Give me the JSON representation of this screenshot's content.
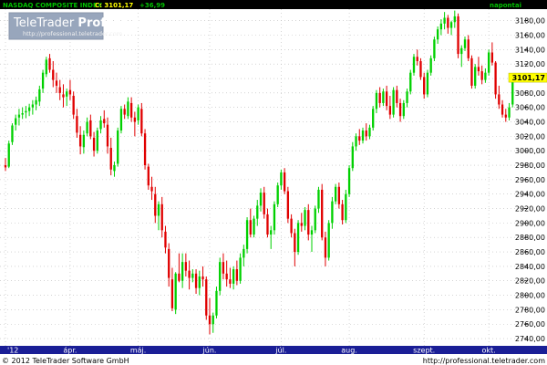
{
  "header": {
    "instrument": "NASDAQ COMPOSITE INDEX",
    "close_label": "C: 3101,17",
    "change": "+36,99",
    "range": "napontai"
  },
  "watermark": {
    "brand_plain": "TeleTrader ",
    "brand_bold": "Professional",
    "url": "http://professional.teletrader.com"
  },
  "footer": {
    "copyright": "© 2012 TeleTrader Software GmbH",
    "url": "http://professional.teletrader.com"
  },
  "colors": {
    "up": "#00d000",
    "down": "#e00000",
    "header_bg": "#000000",
    "header_text": "#00c000",
    "price_badge": "#ffff00",
    "axis_bar": "#1a1e96",
    "grid": "#bbbbbb"
  },
  "chart_data": {
    "type": "candlestick",
    "y_ticks": [
      "3180,00",
      "3160,00",
      "3140,00",
      "3120,00",
      "3100,00",
      "3080,00",
      "3060,00",
      "3040,00",
      "3020,00",
      "3000,00",
      "2980,00",
      "2960,00",
      "2940,00",
      "2920,00",
      "2900,00",
      "2880,00",
      "2860,00",
      "2840,00",
      "2820,00",
      "2800,00",
      "2780,00",
      "2760,00",
      "2740,00"
    ],
    "y_tick_values": [
      3180,
      3160,
      3140,
      3120,
      3100,
      3080,
      3060,
      3040,
      3020,
      3000,
      2980,
      2960,
      2940,
      2920,
      2900,
      2880,
      2860,
      2840,
      2820,
      2800,
      2780,
      2760,
      2740
    ],
    "ylim": [
      2730,
      3196
    ],
    "x_ticks": [
      {
        "label": "'12",
        "index": 0
      },
      {
        "label": "ápr.",
        "index": 19
      },
      {
        "label": "máj.",
        "index": 39
      },
      {
        "label": "jún.",
        "index": 60
      },
      {
        "label": "júl.",
        "index": 81
      },
      {
        "label": "aug.",
        "index": 101
      },
      {
        "label": "szept.",
        "index": 123
      },
      {
        "label": "okt.",
        "index": 142
      }
    ],
    "last_price": "3101,17",
    "last_value": 3101.17,
    "ohlc": [
      [
        2980,
        2990,
        2972,
        2977
      ],
      [
        2978,
        3014,
        2976,
        3010
      ],
      [
        3012,
        3038,
        3008,
        3035
      ],
      [
        3036,
        3050,
        3028,
        3045
      ],
      [
        3046,
        3058,
        3035,
        3050
      ],
      [
        3050,
        3060,
        3044,
        3052
      ],
      [
        3053,
        3062,
        3045,
        3055
      ],
      [
        3055,
        3065,
        3048,
        3060
      ],
      [
        3060,
        3070,
        3050,
        3064
      ],
      [
        3064,
        3075,
        3056,
        3070
      ],
      [
        3068,
        3090,
        3062,
        3085
      ],
      [
        3086,
        3112,
        3080,
        3108
      ],
      [
        3106,
        3130,
        3102,
        3126
      ],
      [
        3128,
        3134,
        3108,
        3112
      ],
      [
        3112,
        3124,
        3088,
        3098
      ],
      [
        3097,
        3108,
        3080,
        3090
      ],
      [
        3088,
        3098,
        3070,
        3080
      ],
      [
        3078,
        3092,
        3060,
        3074
      ],
      [
        3075,
        3086,
        3062,
        3082
      ],
      [
        3084,
        3098,
        3070,
        3078
      ],
      [
        3076,
        3082,
        3044,
        3050
      ],
      [
        3048,
        3058,
        3018,
        3025
      ],
      [
        3022,
        3034,
        2995,
        3006
      ],
      [
        3005,
        3028,
        2996,
        3022
      ],
      [
        3024,
        3046,
        3020,
        3040
      ],
      [
        3042,
        3050,
        3016,
        3020
      ],
      [
        3018,
        3026,
        2992,
        3000
      ],
      [
        3000,
        3032,
        2996,
        3028
      ],
      [
        3030,
        3048,
        3024,
        3042
      ],
      [
        3044,
        3056,
        3032,
        3038
      ],
      [
        3036,
        3046,
        2996,
        3006
      ],
      [
        3004,
        3018,
        2966,
        2974
      ],
      [
        2972,
        2985,
        2964,
        2980
      ],
      [
        2982,
        3032,
        2978,
        3028
      ],
      [
        3028,
        3062,
        3024,
        3058
      ],
      [
        3058,
        3064,
        3044,
        3050
      ],
      [
        3048,
        3074,
        3044,
        3068
      ],
      [
        3066,
        3074,
        3040,
        3046
      ],
      [
        3046,
        3054,
        3020,
        3040
      ],
      [
        3042,
        3064,
        3036,
        3060
      ],
      [
        3058,
        3066,
        3020,
        3024
      ],
      [
        3024,
        3030,
        2974,
        2980
      ],
      [
        2978,
        2982,
        2946,
        2952
      ],
      [
        2950,
        2964,
        2932,
        2944
      ],
      [
        2940,
        2950,
        2900,
        2910
      ],
      [
        2910,
        2930,
        2890,
        2926
      ],
      [
        2926,
        2936,
        2880,
        2890
      ],
      [
        2888,
        2896,
        2858,
        2866
      ],
      [
        2864,
        2872,
        2812,
        2824
      ],
      [
        2822,
        2838,
        2778,
        2782
      ],
      [
        2780,
        2832,
        2774,
        2830
      ],
      [
        2830,
        2858,
        2818,
        2820
      ],
      [
        2820,
        2858,
        2810,
        2846
      ],
      [
        2846,
        2858,
        2826,
        2834
      ],
      [
        2834,
        2848,
        2808,
        2824
      ],
      [
        2824,
        2836,
        2818,
        2830
      ],
      [
        2830,
        2836,
        2802,
        2810
      ],
      [
        2810,
        2834,
        2800,
        2826
      ],
      [
        2826,
        2840,
        2812,
        2822
      ],
      [
        2822,
        2826,
        2766,
        2772
      ],
      [
        2772,
        2796,
        2746,
        2760
      ],
      [
        2760,
        2776,
        2748,
        2772
      ],
      [
        2772,
        2812,
        2768,
        2806
      ],
      [
        2806,
        2852,
        2800,
        2846
      ],
      [
        2846,
        2858,
        2822,
        2830
      ],
      [
        2830,
        2848,
        2812,
        2822
      ],
      [
        2822,
        2838,
        2810,
        2816
      ],
      [
        2816,
        2840,
        2808,
        2836
      ],
      [
        2836,
        2848,
        2814,
        2820
      ],
      [
        2820,
        2858,
        2816,
        2852
      ],
      [
        2852,
        2870,
        2840,
        2864
      ],
      [
        2864,
        2908,
        2858,
        2904
      ],
      [
        2904,
        2920,
        2880,
        2884
      ],
      [
        2884,
        2910,
        2880,
        2906
      ],
      [
        2906,
        2932,
        2896,
        2924
      ],
      [
        2924,
        2948,
        2916,
        2942
      ],
      [
        2942,
        2950,
        2906,
        2912
      ],
      [
        2912,
        2920,
        2880,
        2884
      ],
      [
        2884,
        2896,
        2864,
        2890
      ],
      [
        2890,
        2930,
        2884,
        2926
      ],
      [
        2926,
        2956,
        2922,
        2952
      ],
      [
        2952,
        2974,
        2946,
        2970
      ],
      [
        2970,
        2976,
        2940,
        2944
      ],
      [
        2944,
        2950,
        2900,
        2906
      ],
      [
        2906,
        2912,
        2880,
        2886
      ],
      [
        2886,
        2892,
        2840,
        2860
      ],
      [
        2860,
        2904,
        2856,
        2900
      ],
      [
        2900,
        2914,
        2888,
        2896
      ],
      [
        2896,
        2922,
        2890,
        2918
      ],
      [
        2918,
        2926,
        2876,
        2884
      ],
      [
        2884,
        2896,
        2860,
        2890
      ],
      [
        2890,
        2924,
        2886,
        2920
      ],
      [
        2920,
        2950,
        2914,
        2946
      ],
      [
        2946,
        2954,
        2876,
        2880
      ],
      [
        2880,
        2888,
        2840,
        2852
      ],
      [
        2852,
        2904,
        2848,
        2900
      ],
      [
        2900,
        2936,
        2892,
        2930
      ],
      [
        2930,
        2954,
        2926,
        2950
      ],
      [
        2950,
        2956,
        2920,
        2926
      ],
      [
        2926,
        2932,
        2898,
        2904
      ],
      [
        2904,
        2946,
        2900,
        2940
      ],
      [
        2940,
        2980,
        2936,
        2976
      ],
      [
        2976,
        3012,
        2972,
        3006
      ],
      [
        3006,
        3024,
        3000,
        3020
      ],
      [
        3020,
        3030,
        3008,
        3014
      ],
      [
        3014,
        3032,
        3010,
        3028
      ],
      [
        3028,
        3038,
        3014,
        3020
      ],
      [
        3020,
        3036,
        3016,
        3032
      ],
      [
        3032,
        3062,
        3028,
        3058
      ],
      [
        3058,
        3084,
        3052,
        3080
      ],
      [
        3080,
        3088,
        3060,
        3066
      ],
      [
        3066,
        3086,
        3062,
        3082
      ],
      [
        3082,
        3090,
        3056,
        3062
      ],
      [
        3062,
        3076,
        3044,
        3050
      ],
      [
        3050,
        3088,
        3046,
        3084
      ],
      [
        3084,
        3090,
        3060,
        3066
      ],
      [
        3066,
        3072,
        3040,
        3048
      ],
      [
        3048,
        3070,
        3044,
        3066
      ],
      [
        3066,
        3086,
        3060,
        3082
      ],
      [
        3082,
        3112,
        3078,
        3108
      ],
      [
        3108,
        3134,
        3104,
        3130
      ],
      [
        3130,
        3140,
        3118,
        3124
      ],
      [
        3124,
        3128,
        3098,
        3102
      ],
      [
        3102,
        3108,
        3072,
        3078
      ],
      [
        3078,
        3112,
        3074,
        3108
      ],
      [
        3108,
        3132,
        3104,
        3128
      ],
      [
        3128,
        3158,
        3124,
        3154
      ],
      [
        3154,
        3172,
        3148,
        3168
      ],
      [
        3168,
        3182,
        3160,
        3176
      ],
      [
        3176,
        3192,
        3168,
        3184
      ],
      [
        3184,
        3188,
        3162,
        3170
      ],
      [
        3170,
        3180,
        3160,
        3178
      ],
      [
        3178,
        3194,
        3170,
        3186
      ],
      [
        3186,
        3190,
        3128,
        3134
      ],
      [
        3134,
        3146,
        3116,
        3142
      ],
      [
        3142,
        3158,
        3138,
        3154
      ],
      [
        3154,
        3160,
        3124,
        3128
      ],
      [
        3128,
        3132,
        3086,
        3090
      ],
      [
        3090,
        3120,
        3086,
        3116
      ],
      [
        3116,
        3130,
        3104,
        3110
      ],
      [
        3110,
        3118,
        3092,
        3098
      ],
      [
        3098,
        3114,
        3094,
        3108
      ],
      [
        3108,
        3140,
        3104,
        3136
      ],
      [
        3136,
        3150,
        3118,
        3122
      ],
      [
        3122,
        3124,
        3072,
        3078
      ],
      [
        3078,
        3090,
        3058,
        3064
      ],
      [
        3064,
        3070,
        3046,
        3050
      ],
      [
        3050,
        3058,
        3040,
        3046
      ],
      [
        3046,
        3066,
        3042,
        3060
      ],
      [
        3064,
        3102,
        3060,
        3101.17
      ]
    ]
  }
}
